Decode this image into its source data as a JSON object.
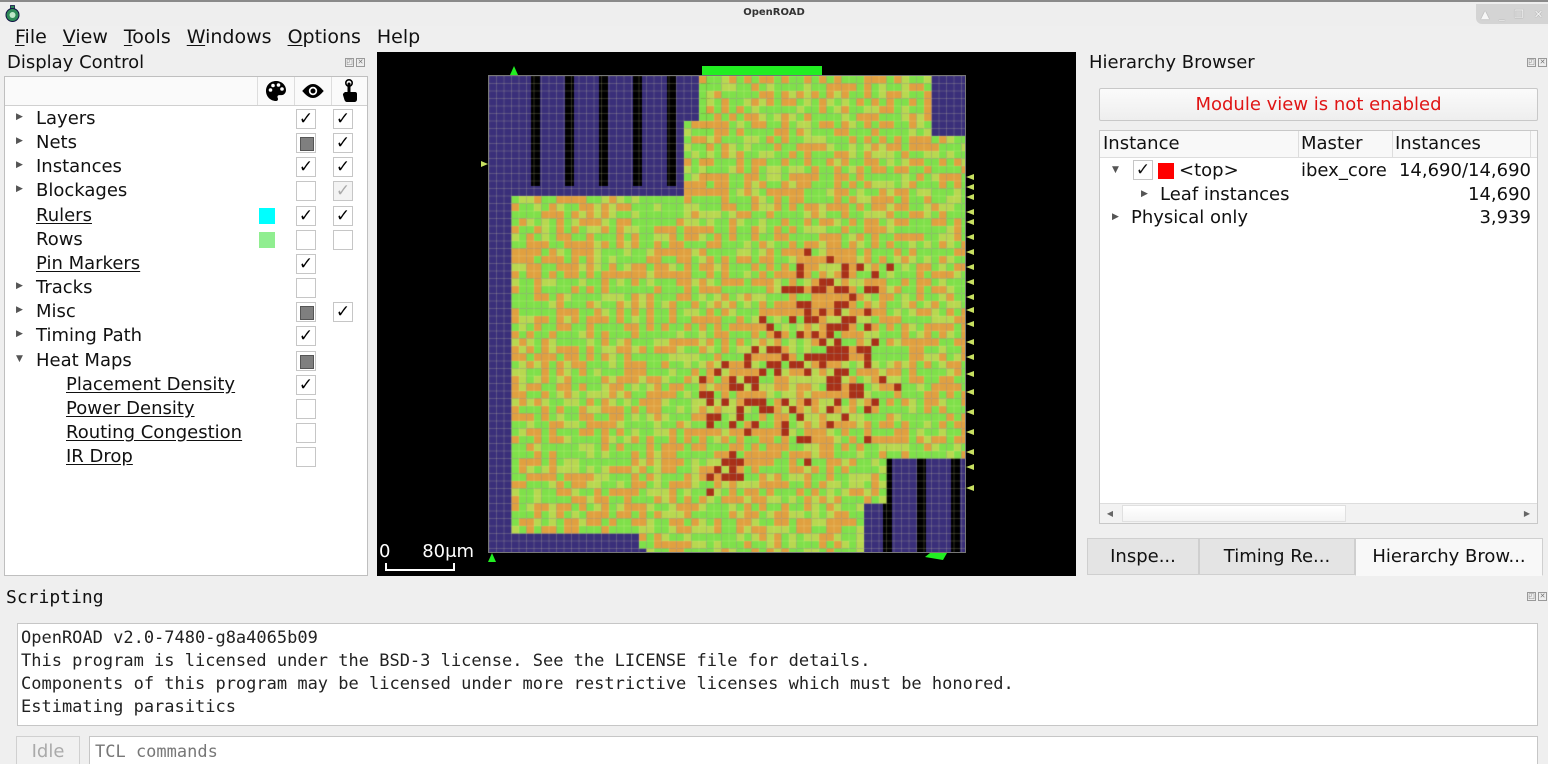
{
  "window": {
    "title": "OpenROAD",
    "controls": [
      "up-icon",
      "minimize-icon",
      "restore-icon",
      "close-icon"
    ]
  },
  "menubar": [
    {
      "label": "File",
      "mnemonic": "F",
      "rest": "ile"
    },
    {
      "label": "View",
      "mnemonic": "V",
      "rest": "iew"
    },
    {
      "label": "Tools",
      "mnemonic": "T",
      "rest": "ools"
    },
    {
      "label": "Windows",
      "mnemonic": "W",
      "rest": "indows"
    },
    {
      "label": "Options",
      "mnemonic": "O",
      "rest": "ptions"
    },
    {
      "label": "Help",
      "mnemonic": "",
      "rest": "Help"
    }
  ],
  "display_control": {
    "title": "Display Control",
    "column_icons": [
      "palette-icon",
      "eye-icon",
      "pointer-hand-icon"
    ],
    "rows": [
      {
        "label": "Layers",
        "expander": "collapsed",
        "indent": 0,
        "link": false,
        "visible": "checked",
        "selectable": "checked"
      },
      {
        "label": "Nets",
        "expander": "collapsed",
        "indent": 0,
        "link": false,
        "visible": "partial",
        "selectable": "checked"
      },
      {
        "label": "Instances",
        "expander": "collapsed",
        "indent": 0,
        "link": false,
        "visible": "checked",
        "selectable": "checked"
      },
      {
        "label": "Blockages",
        "expander": "collapsed",
        "indent": 0,
        "link": false,
        "visible": "unchecked",
        "selectable": "checked-disabled"
      },
      {
        "label": "Rulers",
        "expander": "none",
        "indent": 0,
        "link": true,
        "color": "#00ffff",
        "visible": "checked",
        "selectable": "checked"
      },
      {
        "label": "Rows",
        "expander": "none",
        "indent": 0,
        "link": false,
        "color": "#90ee90",
        "visible": "unchecked",
        "selectable": "unchecked"
      },
      {
        "label": "Pin Markers",
        "expander": "none",
        "indent": 0,
        "link": true,
        "visible": "checked",
        "selectable": null
      },
      {
        "label": "Tracks",
        "expander": "collapsed",
        "indent": 0,
        "link": false,
        "visible": "unchecked",
        "selectable": null
      },
      {
        "label": "Misc",
        "expander": "collapsed",
        "indent": 0,
        "link": false,
        "visible": "partial",
        "selectable": "checked"
      },
      {
        "label": "Timing Path",
        "expander": "collapsed",
        "indent": 0,
        "link": false,
        "visible": "checked",
        "selectable": null
      },
      {
        "label": "Heat Maps",
        "expander": "expanded",
        "indent": 0,
        "link": false,
        "visible": "partial",
        "selectable": null
      },
      {
        "label": "Placement Density",
        "expander": "none",
        "indent": 1,
        "link": true,
        "visible": "checked",
        "selectable": null
      },
      {
        "label": "Power Density",
        "expander": "none",
        "indent": 1,
        "link": true,
        "visible": "unchecked",
        "selectable": null
      },
      {
        "label": "Routing Congestion",
        "expander": "none",
        "indent": 1,
        "link": true,
        "visible": "unchecked",
        "selectable": null
      },
      {
        "label": "IR Drop",
        "expander": "none",
        "indent": 1,
        "link": true,
        "visible": "unchecked",
        "selectable": null
      }
    ]
  },
  "layout_view": {
    "heatmap": "Placement Density",
    "scale_bar": {
      "start": "0",
      "end": "80μm"
    },
    "colors": {
      "background": "#000000",
      "low": "#3a2f7a",
      "mid_low": "#2aa0c8",
      "mid": "#7fe04a",
      "mid_high": "#e0a040",
      "high": "#a83018",
      "pins": "#22ee22",
      "pin_markers": "#c8e060"
    }
  },
  "hierarchy_browser": {
    "title": "Hierarchy Browser",
    "module_view_message": "Module view is not enabled",
    "columns": [
      "Instance",
      "Master",
      "Instances"
    ],
    "rows": [
      {
        "expander": "expanded",
        "checked": true,
        "color": "#ff0000",
        "instance": "<top>",
        "master": "ibex_core",
        "instances": "14,690/14,690",
        "indent": 0
      },
      {
        "expander": "collapsed",
        "checked": null,
        "color": null,
        "instance": "Leaf instances",
        "master": "",
        "instances": "14,690",
        "indent": 1
      },
      {
        "expander": "collapsed",
        "checked": null,
        "color": null,
        "instance": "Physical only",
        "master": "",
        "instances": "3,939",
        "indent": 0
      }
    ]
  },
  "right_tabs": [
    {
      "label": "Inspe...",
      "active": false
    },
    {
      "label": "Timing Re...",
      "active": false
    },
    {
      "label": "Hierarchy Brow...",
      "active": true
    }
  ],
  "scripting": {
    "title": "Scripting",
    "output": [
      "OpenROAD v2.0-7480-g8a4065b09",
      "This program is licensed under the BSD-3 license. See the LICENSE file for details.",
      "Components of this program may be licensed under more restrictive licenses which must be honored.",
      "Estimating parasitics"
    ],
    "status": "Idle",
    "input_value": "",
    "input_placeholder": "TCL commands"
  }
}
